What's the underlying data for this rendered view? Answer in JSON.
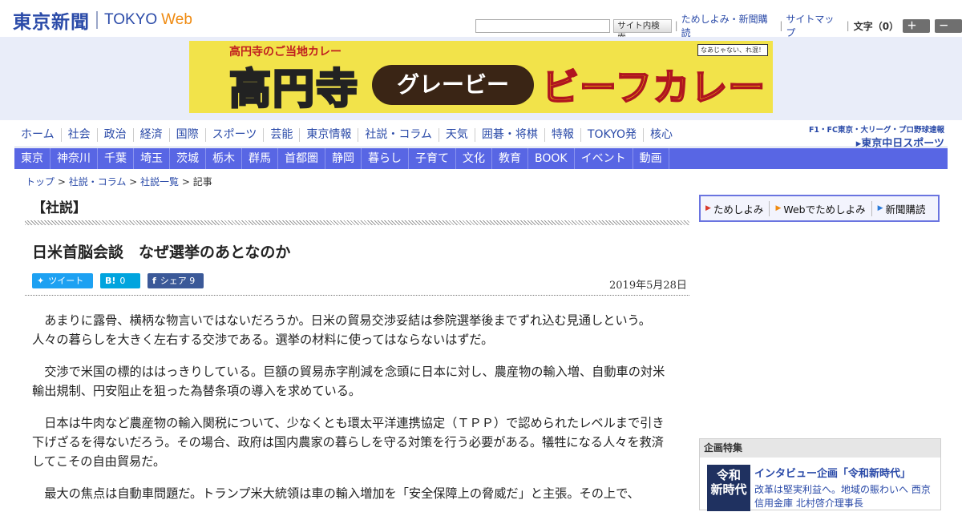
{
  "header": {
    "logo_jp": "東京新聞",
    "logo_en": "TOKYO",
    "logo_web": "Web",
    "search_button": "サイト内検索",
    "search_placeholder": "",
    "links": [
      "ためしよみ・新聞購読",
      "サイトマップ"
    ],
    "font_label": "文字（0）",
    "font_bigger": "＋大",
    "font_smaller": "－小"
  },
  "banner": {
    "top_text": "高円寺のご当地カレー",
    "koenji": "高円寺",
    "gravy": "グレービー",
    "beef_curry": "ビーフカレー",
    "stamp": "なあじゃない、れ混！"
  },
  "nav_main": [
    "ホーム",
    "社会",
    "政治",
    "経済",
    "国際",
    "スポーツ",
    "芸能",
    "東京情報",
    "社説・コラム",
    "天気",
    "囲碁・将棋",
    "特報",
    "TOKYO発",
    "核心"
  ],
  "chunichi": {
    "top": "F1・FC東京・大リーグ・プロ野球速報",
    "main": "▸東京中日スポーツ"
  },
  "nav_regional": [
    "東京",
    "神奈川",
    "千葉",
    "埼玉",
    "茨城",
    "栃木",
    "群馬",
    "首都圏",
    "静岡",
    "暮らし",
    "子育て",
    "文化",
    "教育",
    "BOOK",
    "イベント",
    "動画"
  ],
  "breadcrumb": {
    "items": [
      "トップ",
      "社説・コラム",
      "社説一覧"
    ],
    "current": "記事",
    "sep": " > "
  },
  "article": {
    "section": "【社説】",
    "headline": "日米首脳会談　なぜ選挙のあとなのか",
    "date": "2019年5月28日",
    "share": {
      "tweet": "ツイート",
      "hatena_icon": "B!",
      "hatena_count": "0",
      "facebook": "シェア",
      "facebook_count": "9"
    },
    "paragraphs": [
      "あまりに露骨、横柄な物言いではないだろうか。日米の貿易交渉妥結は参院選挙後までずれ込む見通しという。人々の暮らしを大きく左右する交渉である。選挙の材料に使ってはならないはずだ。",
      "交渉で米国の標的ははっきりしている。巨額の貿易赤字削減を念頭に日本に対し、農産物の輸入増、自動車の対米輸出規制、円安阻止を狙った為替条項の導入を求めている。",
      "日本は牛肉など農産物の輸入関税について、少なくとも環太平洋連携協定（ＴＰＰ）で認められたレベルまで引き下げざるを得ないだろう。その場合、政府は国内農家の暮らしを守る対策を行う必要がある。犠牲になる人々を救済してこその自由貿易だ。",
      "最大の焦点は自動車問題だ。トランプ米大統領は車の輸入増加を「安全保障上の脅威だ」と主張。その上で、"
    ]
  },
  "promo": [
    "ためしよみ",
    "Webでためしよみ",
    "新聞購読"
  ],
  "feature": {
    "heading": "企画特集",
    "thumb_line1": "令和",
    "thumb_line2": "新時代",
    "title": "インタビュー企画「令和新時代」",
    "text": "改革は堅実利益へ。地域の賑わいへ 西京信用金庫 北村啓介理事長"
  }
}
